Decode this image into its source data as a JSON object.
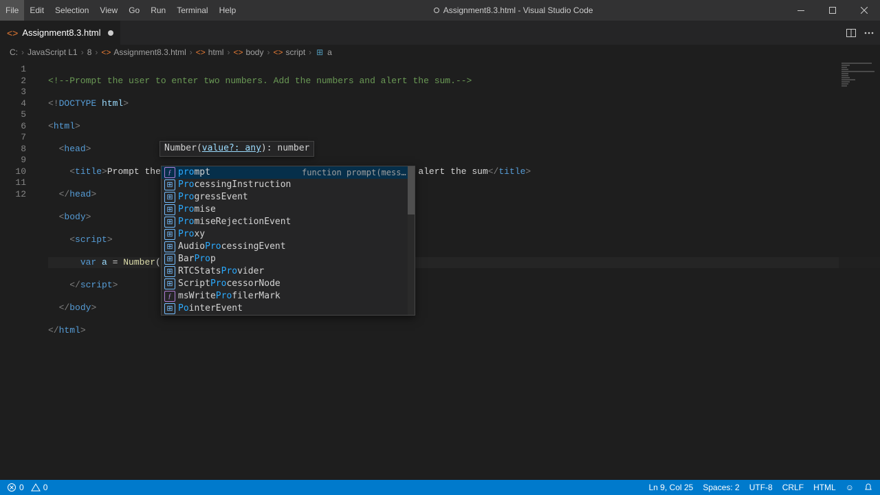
{
  "menu": [
    "File",
    "Edit",
    "Selection",
    "View",
    "Go",
    "Run",
    "Terminal",
    "Help"
  ],
  "window_title": "Assignment8.3.html - Visual Studio Code",
  "tab": {
    "name": "Assignment8.3.html",
    "modified": true
  },
  "breadcrumbs": [
    "C:",
    "JavaScript L1",
    "8",
    "Assignment8.3.html",
    "html",
    "body",
    "script",
    "a"
  ],
  "gutter": [
    "1",
    "2",
    "3",
    "4",
    "5",
    "6",
    "7",
    "8",
    "9",
    "10",
    "11",
    "12"
  ],
  "code": {
    "l1_comment": "<!--Prompt the user to enter two numbers. Add the numbers and alert the sum.-->",
    "l2_pre": "<!",
    "l2_doc": "DOCTYPE",
    "l2_id": " html",
    "l2_post": ">",
    "title_text": "Prompt the user to enter two numbers. Add the numbers and alert the sum",
    "var_kw": "var",
    "var_name": " a ",
    "assign": "= ",
    "fn": "Number",
    "paren_open": "(",
    "arg": "pro",
    "paren_close": ")"
  },
  "signature": {
    "fn": "Number",
    "open": "(",
    "param": "value?: ",
    "ptype": "any",
    "close": "): ",
    "ret": "number"
  },
  "suggestions": [
    {
      "match": "pro",
      "rest": "mpt",
      "kind": "fn",
      "detail": "function prompt(messa…",
      "selected": true
    },
    {
      "match": "Pro",
      "rest": "cessingInstruction",
      "kind": "var"
    },
    {
      "match": "Pro",
      "rest": "gressEvent",
      "kind": "var"
    },
    {
      "match": "Pro",
      "rest": "mise",
      "kind": "var"
    },
    {
      "match": "Pro",
      "rest": "miseRejectionEvent",
      "kind": "var"
    },
    {
      "match": "Pro",
      "rest": "xy",
      "kind": "var"
    },
    {
      "pre": "Audio",
      "match": "Pro",
      "rest": "cessingEvent",
      "kind": "var"
    },
    {
      "pre": "Bar",
      "match": "Pro",
      "rest": "p",
      "kind": "var"
    },
    {
      "pre": "RTCStats",
      "match": "Pro",
      "rest": "vider",
      "kind": "var"
    },
    {
      "pre": "Script",
      "match": "Pro",
      "rest": "cessorNode",
      "kind": "var"
    },
    {
      "pre": "msWrite",
      "match": "Pro",
      "rest": "filerMark",
      "kind": "fn"
    },
    {
      "pre": "",
      "match": "Po",
      "rest": "interEvent",
      "kind": "var"
    }
  ],
  "status": {
    "errors": "0",
    "warnings": "0",
    "ln": "Ln 9, Col 25",
    "spaces": "Spaces: 2",
    "enc": "UTF-8",
    "eol": "CRLF",
    "lang": "HTML",
    "feedback": "☺"
  }
}
